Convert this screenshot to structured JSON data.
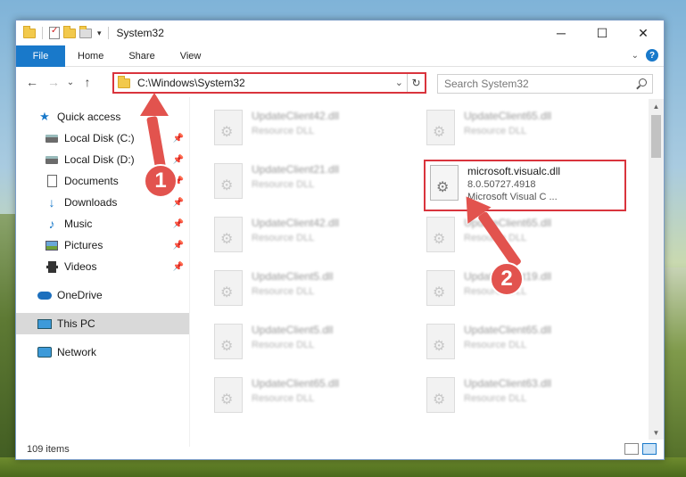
{
  "window": {
    "title": "System32",
    "controls": {
      "minimize": "─",
      "maximize": "☐",
      "close": "✕"
    }
  },
  "ribbon": {
    "tabs": [
      "File",
      "Home",
      "Share",
      "View"
    ],
    "collapse_icon": "chevron-down-icon",
    "help_label": "?"
  },
  "nav": {
    "back": "←",
    "forward": "→",
    "recent": "⌄",
    "up": "↑",
    "address": "C:\\Windows\\System32",
    "search_placeholder": "Search System32"
  },
  "sidebar": {
    "items": [
      {
        "label": "Quick access",
        "icon": "star-icon",
        "pinned": false
      },
      {
        "label": "Local Disk (C:)",
        "icon": "drive-icon",
        "pinned": true
      },
      {
        "label": "Local Disk (D:)",
        "icon": "drive-icon",
        "pinned": true
      },
      {
        "label": "Documents",
        "icon": "document-icon",
        "pinned": true
      },
      {
        "label": "Downloads",
        "icon": "download-icon",
        "pinned": true
      },
      {
        "label": "Music",
        "icon": "music-icon",
        "pinned": true
      },
      {
        "label": "Pictures",
        "icon": "pictures-icon",
        "pinned": true
      },
      {
        "label": "Videos",
        "icon": "videos-icon",
        "pinned": true
      },
      {
        "label": "OneDrive",
        "icon": "cloud-icon",
        "pinned": false
      },
      {
        "label": "This PC",
        "icon": "computer-icon",
        "pinned": false,
        "selected": true
      },
      {
        "label": "Network",
        "icon": "network-icon",
        "pinned": false
      }
    ]
  },
  "files": [
    {
      "name": "UpdateClient42.dll",
      "type": "Resource DLL"
    },
    {
      "name": "UpdateClient65.dll",
      "type": "Resource DLL"
    },
    {
      "name": "UpdateClient21.dll",
      "type": "Resource DLL"
    },
    {
      "name": "microsoft.visualc.dll",
      "version": "8.0.50727.4918",
      "type": "Microsoft Visual C ...",
      "highlighted": true
    },
    {
      "name": "UpdateClient42.dll",
      "type": "Resource DLL"
    },
    {
      "name": "UpdateClient65.dll",
      "type": "Resource DLL"
    },
    {
      "name": "UpdateClient5.dll",
      "type": "Resource DLL"
    },
    {
      "name": "UpdateClient19.dll",
      "type": "Resource DLL"
    },
    {
      "name": "UpdateClient5.dll",
      "type": "Resource DLL"
    },
    {
      "name": "UpdateClient65.dll",
      "type": "Resource DLL"
    },
    {
      "name": "UpdateClient65.dll",
      "type": "Resource DLL"
    },
    {
      "name": "UpdateClient63.dll",
      "type": "Resource DLL"
    }
  ],
  "status": {
    "item_count": "109 items"
  },
  "annotations": {
    "step1": "1",
    "step2": "2"
  },
  "colors": {
    "accent": "#1979ca",
    "highlight": "#d9343d",
    "annotation": "#e2534e",
    "selected_bg": "#d9d9d9"
  }
}
